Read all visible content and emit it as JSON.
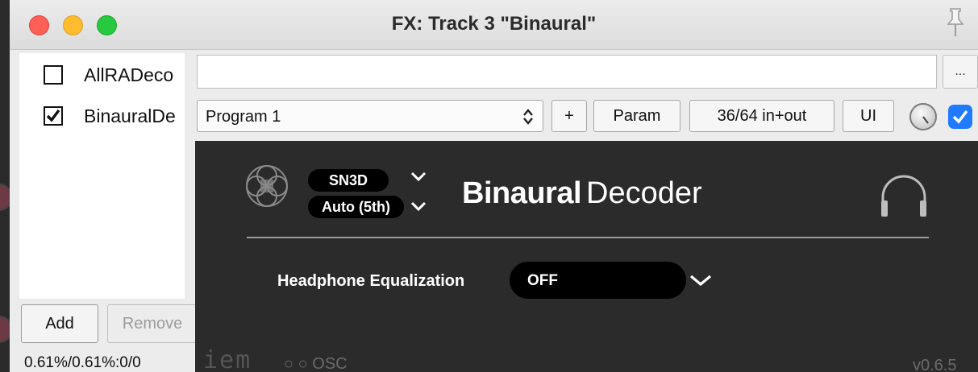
{
  "window": {
    "title": "FX: Track 3 \"Binaural\""
  },
  "fx_list": {
    "items": [
      {
        "name": "AllRADeco",
        "enabled": false
      },
      {
        "name": "BinauralDe",
        "enabled": true
      }
    ],
    "add_label": "Add",
    "remove_label": "Remove",
    "cpu_readout": "0.61%/0.61%:0/0"
  },
  "toolbar": {
    "filter_value": "",
    "more_label": "...",
    "preset": "Program 1",
    "plus_label": "+",
    "param_label": "Param",
    "routing_label": "36/64 in+out",
    "ui_label": "UI",
    "bypass_enabled": true
  },
  "plugin": {
    "normalization": "SN3D",
    "order": "Auto (5th)",
    "brand_bold": "Binaural",
    "brand_light": "Decoder",
    "eq_label": "Headphone Equalization",
    "eq_value": "OFF",
    "osc_label": "OSC",
    "version": "v0.6.5"
  },
  "colors": {
    "plugin_bg": "#2b2b2b",
    "accent_blue": "#1f7aff",
    "close": "#fe5f57",
    "minimize": "#febc2e",
    "zoom": "#28c840"
  }
}
